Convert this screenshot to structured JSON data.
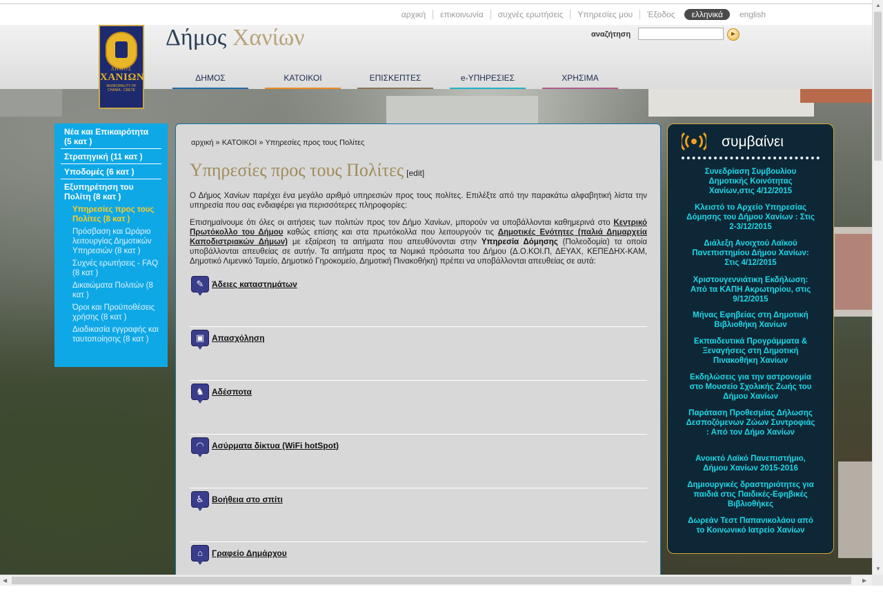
{
  "top_links": [
    "αρχική",
    "επικοινωνία",
    "συχνές ερωτήσεις",
    "Υπηρεσίες μου",
    "Έξοδος",
    "ελληνικά",
    "english"
  ],
  "logo": {
    "top": "ΔΗΜΟΣ",
    "name": "ΧΑΝΙΩΝ",
    "sub": "MUNICIPALITY OF CHANIA · CRETE"
  },
  "site_title": {
    "part1": "Δήμος",
    "part2": "Χανίων"
  },
  "search": {
    "label": "αναζήτηση",
    "value": "",
    "go": "►"
  },
  "nav": [
    {
      "label": "ΔΗΜΟΣ",
      "color": "#1f6aa8"
    },
    {
      "label": "ΚΑΤΟΙΚΟΙ",
      "color": "#f08a1c"
    },
    {
      "label": "ΕΠΙΣΚΕΠΤΕΣ",
      "color": "#8c7255"
    },
    {
      "label": "e-ΥΠΗΡΕΣΙΕΣ",
      "color": "#1eb4c8"
    },
    {
      "label": "ΧΡΗΣΙΜΑ",
      "color": "#b05a8c"
    }
  ],
  "sidebar": {
    "items": [
      "Νέα και Επικαιρότητα (5 κατ )",
      "Στρατηγική (11 κατ )",
      "Υποδομές (6 κατ )",
      "Εξυπηρέτηση του Πολίτη (8 κατ )"
    ],
    "subitems": [
      "Υπηρεσίες προς τους Πολίτες (8 κατ )",
      "Πρόσβαση και Ωράριο λειτουργίας Δημοτικών Υπηρεσιών (8 κατ )",
      "Συχνές ερωτήσεις - FAQ (8 κατ )",
      "Δικαιώματα Πολιτών (8 κατ )",
      "Όροι και Προϋποθέσεις χρήσης (8 κατ )",
      "Διαδικασία εγγραφής και ταυτοποίησης (8 κατ )"
    ]
  },
  "breadcrumb": {
    "home": "αρχική",
    "sep": " » ",
    "section": "ΚΑΤΟΙΚΟΙ",
    "current": "Υπηρεσίες προς τους Πολίτες"
  },
  "page": {
    "title": "Υπηρεσίες προς τους Πολίτες",
    "edit": "[edit]",
    "intro": "Ο Δήμος Χανίων παρέχει ένα μεγάλο αριθμό υπηρεσιών προς τους πολίτες.  Επιλέξτε από την παρακάτω αλφαβητική λίστα την υπηρεσία που σας ενδιαφέρει για περισσότερες πληροφορίες:",
    "notice": {
      "t1": "Επισημαίνουμε ότι όλες οι αιτήσεις των πολιτών προς τον Δήμο Χανίων, μπορούν να υποβάλλονται καθημερινά στο ",
      "l1": "Κεντρικό Πρωτόκολλο του Δήμου",
      "t2": " καθώς επίσης και στα πρωτόκολλα που λειτουργούν τις ",
      "l2": "Δημοτικές Ενότητες (παλιά Δημαρχεία Καποδιστριακών Δήμων)",
      "t3": " με εξαίρεση τα αιτήματα που απευθύνονται στην ",
      "b1": "Υπηρεσία Δόμησης",
      "t4": " (Πολεοδομία) τα οποία υποβάλλονται απευθείας σε αυτήν.  Τα αιτήματα προς τα Νομικά πρόσωπα του Δήμου (Δ.Ο.ΚΟΙ.Π, ΔΕΥΑΧ, ΚΕΠΕΔΗΧ-ΚΑΜ, Δημοτικό Λιμενικό Ταμείο, Δημοτικό Γηροκομείο, Δημοτική Πινακοθήκη) πρέπει να υποβάλλονται απευθείας σε αυτά:"
    },
    "services": [
      {
        "label": "Άδειες καταστημάτων",
        "icon": "document-icon",
        "glyph": "✎"
      },
      {
        "label": "Απασχόληση",
        "icon": "id-card-icon",
        "glyph": "▣"
      },
      {
        "label": "Αδέσποτα",
        "icon": "dog-icon",
        "glyph": "♞"
      },
      {
        "label": "Ασύρματα δίκτυα (WiFi hotSpot)",
        "icon": "wifi-icon",
        "glyph": "◠"
      },
      {
        "label": "Βοήθεια στο σπίτι",
        "icon": "helper-icon",
        "glyph": "♿"
      },
      {
        "label": "Γραφείο Δημάρχου",
        "icon": "building-icon",
        "glyph": "⌂"
      }
    ]
  },
  "events": {
    "title": "συμβαίνει",
    "items": [
      "Συνεδρίαση Συμβουλίου Δημοτικής Κοινότητας Χανίων,στις 4/12/2015",
      "Κλειστό το Αρχείο Υπηρεσίας Δόμησης του Δήμου Χανίων : Στις 2-3/12/2015",
      "Διάλεξη Ανοιχτού Λαϊκού Πανεπιστημίου Δήμου Χανίων: Στις 4/12/2015",
      "Χριστουγεννιάτικη Εκδήλωση: Από τα ΚΑΠΗ Ακρωτηρίου, στις 9/12/2015",
      "Μήνας Εφηβείας στη Δημοτική Βιβλιοθήκη Χανίων",
      "Εκπαιδευτικά Προγράμματα & Ξεναγήσεις στη Δημοτική Πινακοθήκη Χανίων",
      "Εκδηλώσεις για την αστρονομία στο Μουσείο Σχολικής Ζωής του Δήμου Χανίων",
      "Παράταση Προθεσμίας Δήλωσης Δεσποζόμενων Ζώων Συντροφιάς : Από τον Δήμο Χανίων",
      "Ανοικτό Λαϊκό Πανεπιστήμιο, Δήμου Χανίων 2015-2016",
      "Δημιουργικές δραστηριότητες για παιδιά στις Παιδικές-Εφηβικές Βιβλιοθήκες",
      "Δωρεάν Τεστ Παπανικολάου από το Κοινωνικό Ιατρείο Χανίων"
    ]
  }
}
